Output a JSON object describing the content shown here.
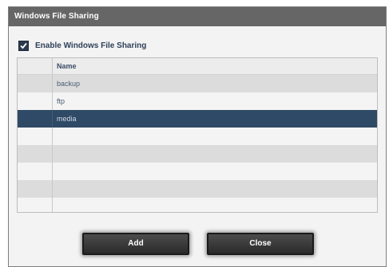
{
  "dialog": {
    "title": "Windows File Sharing"
  },
  "enable_sharing": {
    "label": "Enable Windows File Sharing",
    "checked": true
  },
  "table": {
    "column_header": "Name",
    "rows": [
      "backup",
      "ftp",
      "media",
      "",
      "",
      "",
      "",
      "",
      ""
    ],
    "selected_index": 2
  },
  "buttons": {
    "add_label": "Add",
    "close_label": "Close"
  }
}
